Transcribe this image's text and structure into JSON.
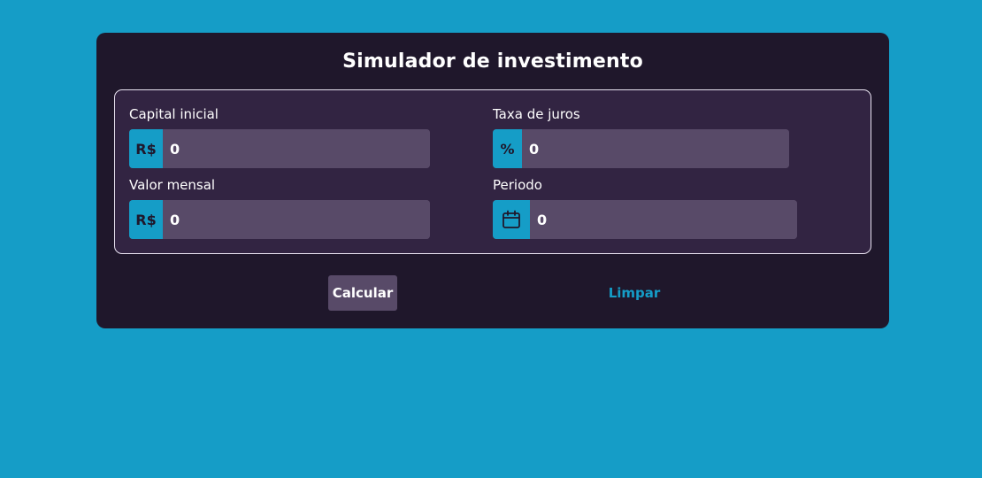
{
  "card": {
    "title": "Simulador de investimento"
  },
  "fields": {
    "capital_inicial": {
      "label": "Capital inicial",
      "prefix": "R$",
      "value": "0"
    },
    "taxa_de_juros": {
      "label": "Taxa de juros",
      "prefix": "%",
      "value": "0"
    },
    "valor_mensal": {
      "label": "Valor mensal",
      "prefix": "R$",
      "value": "0"
    },
    "periodo": {
      "label": "Periodo",
      "prefix_icon": "calendar-icon",
      "value": "0"
    }
  },
  "actions": {
    "calcular_label": "Calcular",
    "limpar_label": "Limpar"
  },
  "colors": {
    "background": "#159dc7",
    "card": "#1f172b",
    "panel": "#322442",
    "input": "#584a68",
    "accent": "#159dc7",
    "text": "#ffffff"
  }
}
